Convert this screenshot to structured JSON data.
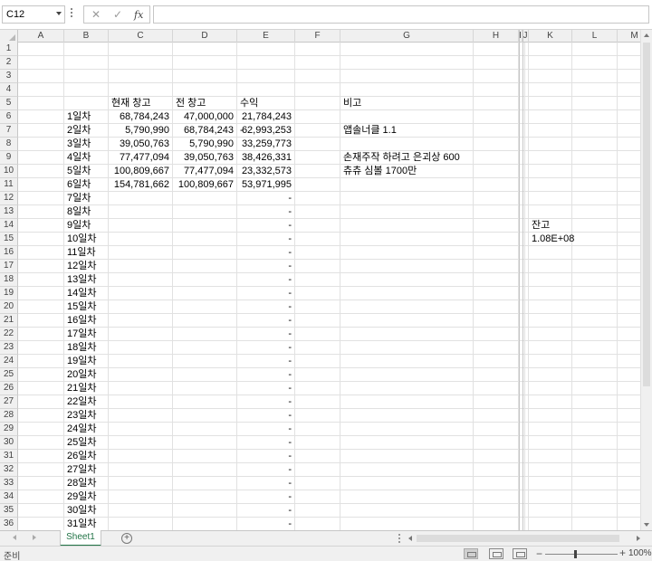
{
  "formula_bar": {
    "name_box": "C12",
    "fx_label": "fx",
    "cancel_glyph": "✕",
    "enter_glyph": "✓",
    "formula": ""
  },
  "columns": [
    "A",
    "B",
    "C",
    "D",
    "E",
    "F",
    "G",
    "H",
    "I",
    "J",
    "K",
    "L",
    "M"
  ],
  "rows": [
    {
      "n": "1"
    },
    {
      "n": "2"
    },
    {
      "n": "3"
    },
    {
      "n": "4"
    },
    {
      "n": "5",
      "B": "",
      "C": "현재 창고",
      "D": "전 창고",
      "E": "수익",
      "G": "비고"
    },
    {
      "n": "6",
      "B": "1일차",
      "C": "68,784,243",
      "D": "47,000,000",
      "E": "21,784,243"
    },
    {
      "n": "7",
      "B": "2일차",
      "C": "5,790,990",
      "D": "68,784,243",
      "E": "62,993,253",
      "E_dash": "-",
      "G": "앱솔너클 1.1"
    },
    {
      "n": "8",
      "B": "3일차",
      "C": "39,050,763",
      "D": "5,790,990",
      "E": "33,259,773"
    },
    {
      "n": "9",
      "B": "4일차",
      "C": "77,477,094",
      "D": "39,050,763",
      "E": "38,426,331",
      "G": "손재주작 하려고 은괴상 600"
    },
    {
      "n": "10",
      "B": "5일차",
      "C": "100,809,667",
      "D": "77,477,094",
      "E": "23,332,573",
      "G": "츄츄 심볼 1700만"
    },
    {
      "n": "11",
      "B": "6일차",
      "C": "154,781,662",
      "D": "100,809,667",
      "E": "53,971,995"
    },
    {
      "n": "12",
      "B": "7일차",
      "E": "-"
    },
    {
      "n": "13",
      "B": "8일차",
      "E": "-"
    },
    {
      "n": "14",
      "B": "9일차",
      "E": "-",
      "K": "잔고"
    },
    {
      "n": "15",
      "B": "10일차",
      "E": "-",
      "K": "1.08E+08"
    },
    {
      "n": "16",
      "B": "11일차",
      "E": "-"
    },
    {
      "n": "17",
      "B": "12일차",
      "E": "-"
    },
    {
      "n": "18",
      "B": "13일차",
      "E": "-"
    },
    {
      "n": "19",
      "B": "14일차",
      "E": "-"
    },
    {
      "n": "20",
      "B": "15일차",
      "E": "-"
    },
    {
      "n": "21",
      "B": "16일차",
      "E": "-"
    },
    {
      "n": "22",
      "B": "17일차",
      "E": "-"
    },
    {
      "n": "23",
      "B": "18일차",
      "E": "-"
    },
    {
      "n": "24",
      "B": "19일차",
      "E": "-"
    },
    {
      "n": "25",
      "B": "20일차",
      "E": "-"
    },
    {
      "n": "26",
      "B": "21일차",
      "E": "-"
    },
    {
      "n": "27",
      "B": "22일차",
      "E": "-"
    },
    {
      "n": "28",
      "B": "23일차",
      "E": "-"
    },
    {
      "n": "29",
      "B": "24일차",
      "E": "-"
    },
    {
      "n": "30",
      "B": "25일차",
      "E": "-"
    },
    {
      "n": "31",
      "B": "26일차",
      "E": "-"
    },
    {
      "n": "32",
      "B": "27일차",
      "E": "-"
    },
    {
      "n": "33",
      "B": "28일차",
      "E": "-"
    },
    {
      "n": "34",
      "B": "29일차",
      "E": "-"
    },
    {
      "n": "35",
      "B": "30일차",
      "E": "-"
    },
    {
      "n": "36",
      "B": "31일차",
      "E": "-"
    }
  ],
  "sheet_tabs": {
    "active": "Sheet1",
    "add_glyph": "+"
  },
  "status_bar": {
    "ready": "준비",
    "zoom_minus": "−",
    "zoom_plus": "+",
    "zoom": "100%"
  },
  "colors": {
    "accent": "#217346",
    "header_bg": "#f0f0f0",
    "gridline": "#e1e1e1"
  }
}
